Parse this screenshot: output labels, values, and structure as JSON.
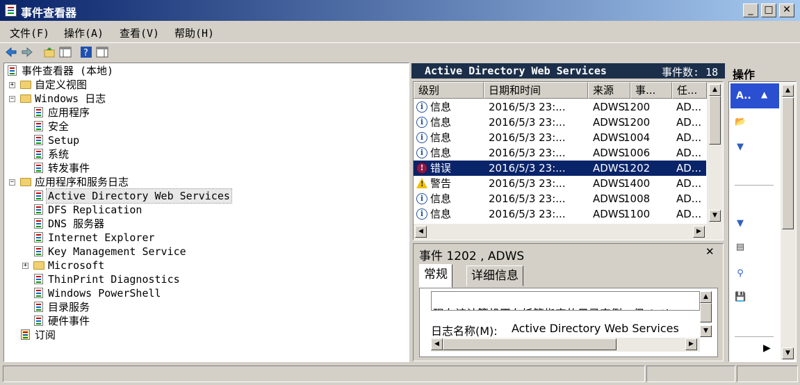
{
  "window": {
    "title": "事件查看器"
  },
  "menu": [
    "文件(F)",
    "操作(A)",
    "查看(V)",
    "帮助(H)"
  ],
  "tree": [
    {
      "label": "事件查看器 (本地)",
      "icon": "event-viewer-icon"
    },
    {
      "label": "自定义视图",
      "icon": "folder-icon",
      "expander": "+"
    },
    {
      "label": "Windows 日志",
      "icon": "folder-icon",
      "expander": "-"
    },
    {
      "label": "应用程序",
      "icon": "log-icon"
    },
    {
      "label": "安全",
      "icon": "log-icon"
    },
    {
      "label": "Setup",
      "icon": "log-icon"
    },
    {
      "label": "系统",
      "icon": "log-icon"
    },
    {
      "label": "转发事件",
      "icon": "log-icon"
    },
    {
      "label": "应用程序和服务日志",
      "icon": "folder-icon",
      "expander": "-"
    },
    {
      "label": "Active Directory Web Services",
      "icon": "log-icon",
      "selected": true
    },
    {
      "label": "DFS Replication",
      "icon": "log-icon"
    },
    {
      "label": "DNS 服务器",
      "icon": "log-icon"
    },
    {
      "label": "Internet Explorer",
      "icon": "log-icon"
    },
    {
      "label": "Key Management Service",
      "icon": "log-icon"
    },
    {
      "label": "Microsoft",
      "icon": "folder-icon",
      "expander": "+"
    },
    {
      "label": "ThinPrint Diagnostics",
      "icon": "log-icon"
    },
    {
      "label": "Windows PowerShell",
      "icon": "log-icon"
    },
    {
      "label": "目录服务",
      "icon": "log-icon"
    },
    {
      "label": "硬件事件",
      "icon": "log-icon"
    },
    {
      "label": "订阅",
      "icon": "subscription-icon"
    }
  ],
  "log_header": {
    "name": "Active Directory Web Services",
    "count_label": "事件数: 18"
  },
  "columns": [
    "级别",
    "日期和时间",
    "来源",
    "事...",
    "任..."
  ],
  "rows": [
    {
      "level": "信息",
      "type": "info",
      "date": "2016/5/3 23:...",
      "source": "ADWS",
      "event": "1200",
      "task": "AD..."
    },
    {
      "level": "信息",
      "type": "info",
      "date": "2016/5/3 23:...",
      "source": "ADWS",
      "event": "1200",
      "task": "AD..."
    },
    {
      "level": "信息",
      "type": "info",
      "date": "2016/5/3 23:...",
      "source": "ADWS",
      "event": "1004",
      "task": "AD..."
    },
    {
      "level": "信息",
      "type": "info",
      "date": "2016/5/3 23:...",
      "source": "ADWS",
      "event": "1006",
      "task": "AD..."
    },
    {
      "level": "错误",
      "type": "err",
      "date": "2016/5/3 23:...",
      "source": "ADWS",
      "event": "1202",
      "task": "AD...",
      "selected": true
    },
    {
      "level": "警告",
      "type": "warn",
      "date": "2016/5/3 23:...",
      "source": "ADWS",
      "event": "1400",
      "task": "AD..."
    },
    {
      "level": "信息",
      "type": "info",
      "date": "2016/5/3 23:...",
      "source": "ADWS",
      "event": "1008",
      "task": "AD..."
    },
    {
      "level": "信息",
      "type": "info",
      "date": "2016/5/3 23:...",
      "source": "ADWS",
      "event": "1100",
      "task": "AD..."
    }
  ],
  "detail": {
    "title": "事件 1202 , ADWS",
    "tabs": [
      "常规",
      "详细信息"
    ],
    "description": "现在该计算机正在托管指定的目录实例，但 Activ",
    "log_name_label": "日志名称(M):",
    "log_name_value": "Active Directory Web Services"
  },
  "actions": {
    "title": "操作",
    "section": "A..",
    "icons": [
      "open-log-icon",
      "filter-icon",
      "filter-icon",
      "properties-icon",
      "find-icon",
      "save-icon"
    ]
  },
  "colors": {
    "selection": "#0a246a",
    "header_dark": "#1c2f4a",
    "error": "#8b1a4a",
    "warning": "#f0c000"
  }
}
